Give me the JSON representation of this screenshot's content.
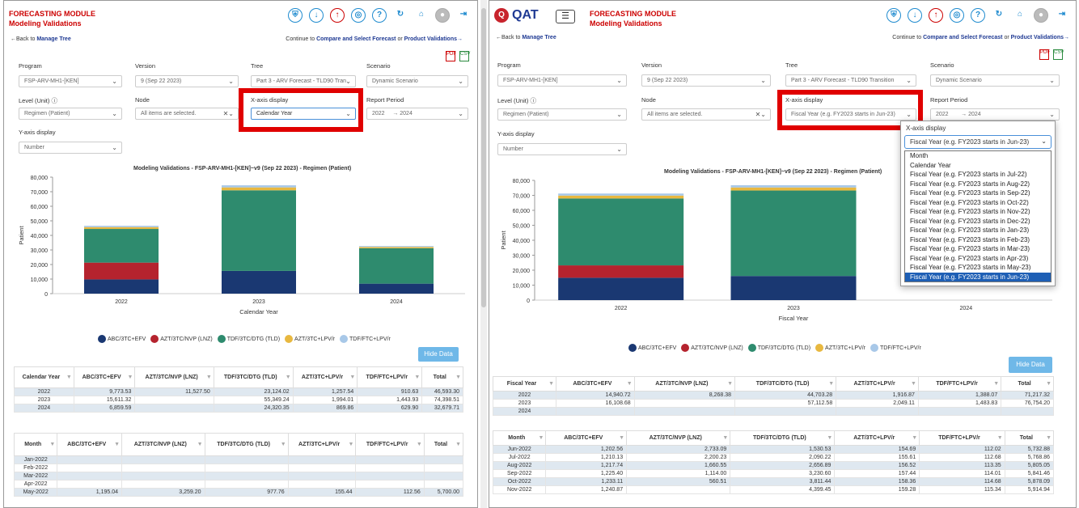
{
  "colors": {
    "abc": "#1a3872",
    "azt_nvp": "#b5232e",
    "tdf_dtg": "#2e8b6e",
    "azt_lpv": "#e8b840",
    "tdf_ftc": "#a8c8e8",
    "accent": "#1f3a93",
    "red": "#c00000"
  },
  "icons": [
    "shield-icon",
    "cloud-download-icon",
    "cloud-upload-icon",
    "compass-icon",
    "help-icon",
    "refresh-icon",
    "home-icon",
    "user-avatar-icon",
    "logout-icon"
  ],
  "left": {
    "module": "FORECASTING MODULE",
    "sub": "Modeling Validations",
    "back": "←Back to",
    "back_link": "Manage Tree",
    "continue": "Continue to",
    "compare": "Compare and Select Forecast",
    "or": "or",
    "product": "Product Validations→",
    "labels": {
      "program": "Program",
      "version": "Version",
      "tree": "Tree",
      "scenario": "Scenario",
      "level": "Level (Unit)",
      "node": "Node",
      "xaxis": "X-axis display",
      "report": "Report Period",
      "yaxis": "Y-axis display"
    },
    "values": {
      "program": "FSP-ARV-MH1-[KEN]",
      "version": "9 (Sep 22 2023)",
      "tree": "Part 3 - ARV Forecast - TLD90 Tran",
      "scenario": "Dynamic Scenario",
      "level": "Regimen (Patient)",
      "node": "All items are selected.",
      "xaxis": "Calendar Year",
      "report_from": "2022",
      "report_sep": "→",
      "report_to": "2024",
      "yaxis": "Number"
    },
    "chart_title": "Modeling Validations - FSP-ARV-MH1-[KEN]~v9 (Sep 22 2023) - Regimen (Patient)",
    "xlabel": "Calendar Year",
    "ylabel": "Patient",
    "hide": "Hide Data",
    "table1_head": [
      "Calendar Year",
      "ABC/3TC+EFV",
      "AZT/3TC/NVP (LNZ)",
      "TDF/3TC/DTG (TLD)",
      "AZT/3TC+LPV/r",
      "TDF/FTC+LPV/r",
      "Total"
    ],
    "table1_rows": [
      [
        "2022",
        "9,773.53",
        "11,527.50",
        "23,124.02",
        "1,257.54",
        "910.63",
        "46,593.30"
      ],
      [
        "2023",
        "15,611.32",
        "",
        "55,349.24",
        "1,994.01",
        "1,443.93",
        "74,398.51"
      ],
      [
        "2024",
        "6,859.59",
        "",
        "24,320.35",
        "869.86",
        "629.90",
        "32,679.71"
      ]
    ],
    "table2_head": [
      "Month",
      "ABC/3TC+EFV",
      "AZT/3TC/NVP (LNZ)",
      "TDF/3TC/DTG (TLD)",
      "AZT/3TC+LPV/r",
      "TDF/FTC+LPV/r",
      "Total"
    ],
    "table2_rows": [
      [
        "Jan-2022",
        "",
        "",
        "",
        "",
        "",
        ""
      ],
      [
        "Feb-2022",
        "",
        "",
        "",
        "",
        "",
        ""
      ],
      [
        "Mar-2022",
        "",
        "",
        "",
        "",
        "",
        ""
      ],
      [
        "Apr-2022",
        "",
        "",
        "",
        "",
        "",
        ""
      ],
      [
        "May-2022",
        "1,195.04",
        "3,259.20",
        "977.76",
        "155.44",
        "112.56",
        "5,700.00"
      ]
    ]
  },
  "right": {
    "logo": "QAT",
    "module": "FORECASTING MODULE",
    "sub": "Modeling Validations",
    "back": "←Back to",
    "back_link": "Manage Tree",
    "continue": "Continue to",
    "compare": "Compare and Select Forecast",
    "or": "or",
    "product": "Product Validations→",
    "labels": {
      "program": "Program",
      "version": "Version",
      "tree": "Tree",
      "scenario": "Scenario",
      "level": "Level (Unit)",
      "node": "Node",
      "xaxis": "X-axis display",
      "report": "Report Period",
      "yaxis": "Y-axis display"
    },
    "values": {
      "program": "FSP-ARV-MH1-[KEN]",
      "version": "9 (Sep 22 2023)",
      "tree": "Part 3 - ARV Forecast - TLD90 Transition",
      "scenario": "Dynamic Scenario",
      "level": "Regimen (Patient)",
      "node": "All items are selected.",
      "xaxis": "Fiscal Year (e.g. FY2023 starts in Jun-23)",
      "report_from": "2022",
      "report_sep": "→",
      "report_to": "2024",
      "yaxis": "Number"
    },
    "chart_title": "Modeling Validations - FSP-ARV-MH1-[KEN]~v9 (Sep 22 2023) - Regimen (Patient)",
    "xlabel": "Fiscal Year",
    "ylabel": "Patient",
    "hide": "Hide Data",
    "dropdown": {
      "label": "X-axis display",
      "selected": "Fiscal Year (e.g. FY2023 starts in Jun-23)",
      "options": [
        "Month",
        "Calendar Year",
        "Fiscal Year (e.g. FY2023 starts in Jul-22)",
        "Fiscal Year (e.g. FY2023 starts in Aug-22)",
        "Fiscal Year (e.g. FY2023 starts in Sep-22)",
        "Fiscal Year (e.g. FY2023 starts in Oct-22)",
        "Fiscal Year (e.g. FY2023 starts in Nov-22)",
        "Fiscal Year (e.g. FY2023 starts in Dec-22)",
        "Fiscal Year (e.g. FY2023 starts in Jan-23)",
        "Fiscal Year (e.g. FY2023 starts in Feb-23)",
        "Fiscal Year (e.g. FY2023 starts in Mar-23)",
        "Fiscal Year (e.g. FY2023 starts in Apr-23)",
        "Fiscal Year (e.g. FY2023 starts in May-23)",
        "Fiscal Year (e.g. FY2023 starts in Jun-23)"
      ]
    },
    "table1_head": [
      "Fiscal Year",
      "ABC/3TC+EFV",
      "AZT/3TC/NVP (LNZ)",
      "TDF/3TC/DTG (TLD)",
      "AZT/3TC+LPV/r",
      "TDF/FTC+LPV/r",
      "Total"
    ],
    "table1_rows": [
      [
        "2022",
        "14,940.72",
        "8,268.38",
        "44,703.28",
        "1,916.87",
        "1,388.07",
        "71,217.32"
      ],
      [
        "2023",
        "16,108.68",
        "",
        "57,112.58",
        "2,049.11",
        "1,483.83",
        "76,754.20"
      ],
      [
        "2024",
        "",
        "",
        "",
        "",
        "",
        ""
      ]
    ],
    "table2_head": [
      "Month",
      "ABC/3TC+EFV",
      "AZT/3TC/NVP (LNZ)",
      "TDF/3TC/DTG (TLD)",
      "AZT/3TC+LPV/r",
      "TDF/FTC+LPV/r",
      "Total"
    ],
    "table2_rows": [
      [
        "Jun-2022",
        "1,202.56",
        "2,733.09",
        "1,530.53",
        "154.69",
        "112.02",
        "5,732.88"
      ],
      [
        "Jul-2022",
        "1,210.13",
        "2,200.23",
        "2,090.22",
        "155.61",
        "112.68",
        "5,768.86"
      ],
      [
        "Aug-2022",
        "1,217.74",
        "1,660.55",
        "2,656.89",
        "156.52",
        "113.35",
        "5,805.05"
      ],
      [
        "Sep-2022",
        "1,225.40",
        "1,114.00",
        "3,230.60",
        "157.44",
        "114.01",
        "5,841.46"
      ],
      [
        "Oct-2022",
        "1,233.11",
        "560.51",
        "3,811.44",
        "158.36",
        "114.68",
        "5,878.09"
      ],
      [
        "Nov-2022",
        "1,240.87",
        "",
        "4,399.45",
        "159.28",
        "115.34",
        "5,914.94"
      ]
    ]
  },
  "chart_data": [
    {
      "type": "bar",
      "stacked": true,
      "title": "Modeling Validations - FSP-ARV-MH1-[KEN]~v9 (Sep 22 2023) - Regimen (Patient)",
      "xlabel": "Calendar Year",
      "ylabel": "Patient",
      "categories": [
        "2022",
        "2023",
        "2024"
      ],
      "ylim": [
        0,
        80000
      ],
      "yticks": [
        "0",
        "10,000",
        "20,000",
        "30,000",
        "40,000",
        "50,000",
        "60,000",
        "70,000",
        "80,000"
      ],
      "series": [
        {
          "name": "ABC/3TC+EFV",
          "values": [
            9773.53,
            15611.32,
            6859.59
          ]
        },
        {
          "name": "AZT/3TC/NVP (LNZ)",
          "values": [
            11527.5,
            0,
            0
          ]
        },
        {
          "name": "TDF/3TC/DTG (TLD)",
          "values": [
            23124.02,
            55349.24,
            24320.35
          ]
        },
        {
          "name": "AZT/3TC+LPV/r",
          "values": [
            1257.54,
            1994.01,
            869.86
          ]
        },
        {
          "name": "TDF/FTC+LPV/r",
          "values": [
            910.63,
            1443.93,
            629.9
          ]
        }
      ],
      "legend": "bottom"
    },
    {
      "type": "bar",
      "stacked": true,
      "title": "Modeling Validations - FSP-ARV-MH1-[KEN]~v9 (Sep 22 2023) - Regimen (Patient)",
      "xlabel": "Fiscal Year",
      "ylabel": "Patient",
      "categories": [
        "2022",
        "2023",
        "2024"
      ],
      "ylim": [
        0,
        80000
      ],
      "yticks": [
        "0",
        "10,000",
        "20,000",
        "30,000",
        "40,000",
        "50,000",
        "60,000",
        "70,000",
        "80,000"
      ],
      "series": [
        {
          "name": "ABC/3TC+EFV",
          "values": [
            14940.72,
            16108.68,
            0
          ]
        },
        {
          "name": "AZT/3TC/NVP (LNZ)",
          "values": [
            8268.38,
            0,
            0
          ]
        },
        {
          "name": "TDF/3TC/DTG (TLD)",
          "values": [
            44703.28,
            57112.58,
            0
          ]
        },
        {
          "name": "AZT/3TC+LPV/r",
          "values": [
            1916.87,
            2049.11,
            0
          ]
        },
        {
          "name": "TDF/FTC+LPV/r",
          "values": [
            1388.07,
            1483.83,
            0
          ]
        }
      ],
      "legend": "bottom"
    }
  ]
}
